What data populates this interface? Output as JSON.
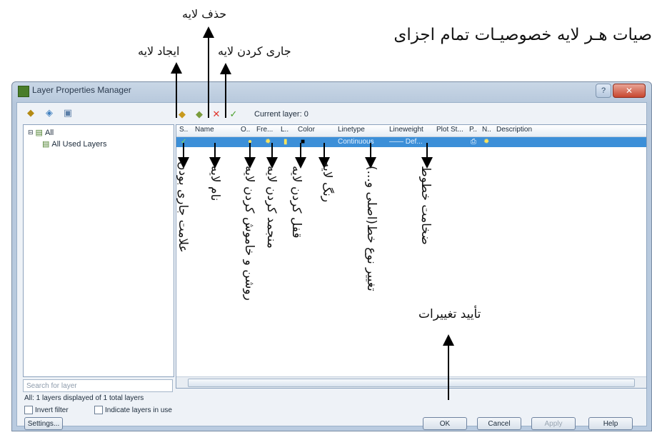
{
  "page": {
    "heading": "صیات هـر لایه خصوصیـات تمام اجزای",
    "annotations": {
      "delete_layer": "حذف لایه",
      "set_current": "جاری کردن لایه",
      "new_layer": "ایجاد لایه",
      "current_mark": "علامت جاری بودن",
      "layer_name": "نام لایه",
      "on_off": "روشن و خاموش کردن لایه",
      "freeze": "منجمد کردن لایه",
      "lock": "قفل کردن لایه",
      "color": "رنگ لایه",
      "linetype": "تغییر نوع خط(اصلی و...)",
      "lineweight": "ضخامت خطوط",
      "apply_changes": "تأیید تغییرات"
    }
  },
  "window": {
    "title": "Layer Properties Manager",
    "current_layer": "Current layer: 0",
    "tree": {
      "root": "All",
      "child": "All Used Layers"
    },
    "search_placeholder": "Search for layer",
    "columns": [
      "S..",
      "Name",
      "O..",
      "Fre...",
      "L..",
      "Color",
      "Linetype",
      "Lineweight",
      "Plot St...",
      "P..",
      "N..",
      "Description"
    ],
    "row": {
      "linetype": "Continuous",
      "lineweight": "—— Def..."
    },
    "status": "All: 1 layers displayed of 1 total layers",
    "checkboxes": {
      "invert_filter": "Invert filter",
      "indicate_layers": "Indicate layers in use"
    },
    "buttons": {
      "settings": "Settings...",
      "ok": "OK",
      "cancel": "Cancel",
      "apply": "Apply",
      "help": "Help"
    }
  },
  "colors": {
    "selected_row": "#3c8fd8",
    "delete_icon": "#e0332a",
    "current_icon": "#4aa02c"
  }
}
